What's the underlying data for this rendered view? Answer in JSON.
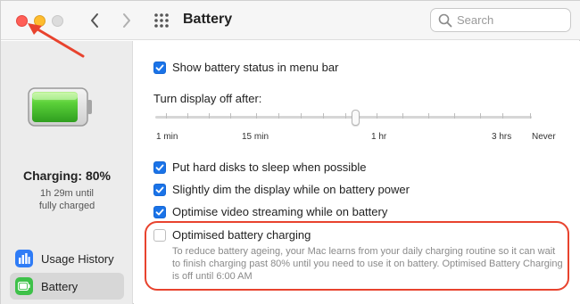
{
  "toolbar": {
    "title": "Battery",
    "search_placeholder": "Search"
  },
  "sidebar": {
    "charging_title": "Charging: 80%",
    "charging_time": "1h 29m until",
    "charging_state": "fully charged",
    "items": [
      {
        "label": "Usage History",
        "icon": "chart-bars-icon"
      },
      {
        "label": "Battery",
        "icon": "battery-icon",
        "selected": true
      }
    ]
  },
  "main": {
    "show_status": {
      "label": "Show battery status in menu bar",
      "checked": true
    },
    "display_off": {
      "label": "Turn display off after:",
      "ticks": [
        "1 min",
        "15 min",
        "1 hr",
        "3 hrs",
        "Never"
      ]
    },
    "sleep_disks": {
      "label": "Put hard disks to sleep when possible",
      "checked": true
    },
    "dim_display": {
      "label": "Slightly dim the display while on battery power",
      "checked": true
    },
    "video_streaming": {
      "label": "Optimise video streaming while on battery",
      "checked": true
    },
    "optimised_charging": {
      "label": "Optimised battery charging",
      "checked": false,
      "description": "To reduce battery ageing, your Mac learns from your daily charging routine so it can wait to finish charging past 80% until you need to use it on battery. Optimised Battery Charging is off until 6:00 AM"
    }
  },
  "colors": {
    "accent": "#1a73e8",
    "annotation": "#e8432e",
    "battery_green": "#3ec149"
  }
}
